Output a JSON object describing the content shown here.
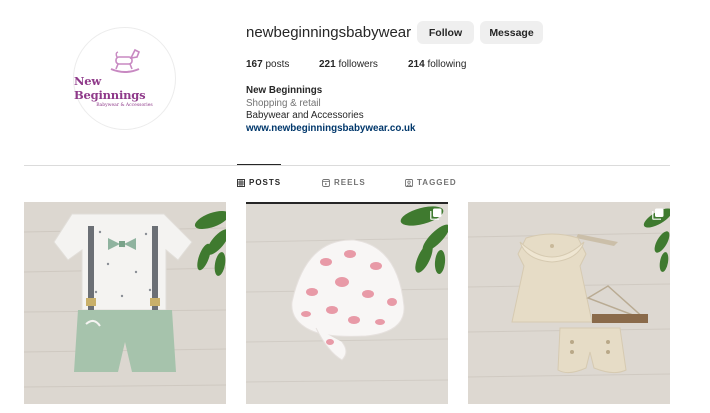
{
  "profile": {
    "username": "newbeginningsbabywear",
    "logo_title": "New Beginnings",
    "logo_subtitle": "Babywear & Accessories",
    "follow_label": "Follow",
    "message_label": "Message",
    "stats": {
      "posts_count": "167",
      "posts_label": "posts",
      "followers_count": "221",
      "followers_label": "followers",
      "following_count": "214",
      "following_label": "following"
    },
    "bio": {
      "name": "New Beginnings",
      "category": "Shopping & retail",
      "description": "Babywear and Accessories",
      "website": "www.newbeginningsbabywear.co.uk"
    }
  },
  "tabs": [
    {
      "label": "POSTS",
      "icon": "grid-icon",
      "active": true
    },
    {
      "label": "REELS",
      "icon": "reels-icon",
      "active": false
    },
    {
      "label": "TAGGED",
      "icon": "tagged-icon",
      "active": false
    }
  ],
  "posts": [
    {
      "subject": "boys outfit with suspenders and green shorts",
      "multi": false
    },
    {
      "subject": "white sun hat with pink shells",
      "multi": true
    },
    {
      "subject": "beige muslin top and shorts set",
      "multi": true
    }
  ],
  "colors": {
    "brand": "#8f3a8a",
    "link": "#00376b",
    "button_bg": "#efefef"
  }
}
